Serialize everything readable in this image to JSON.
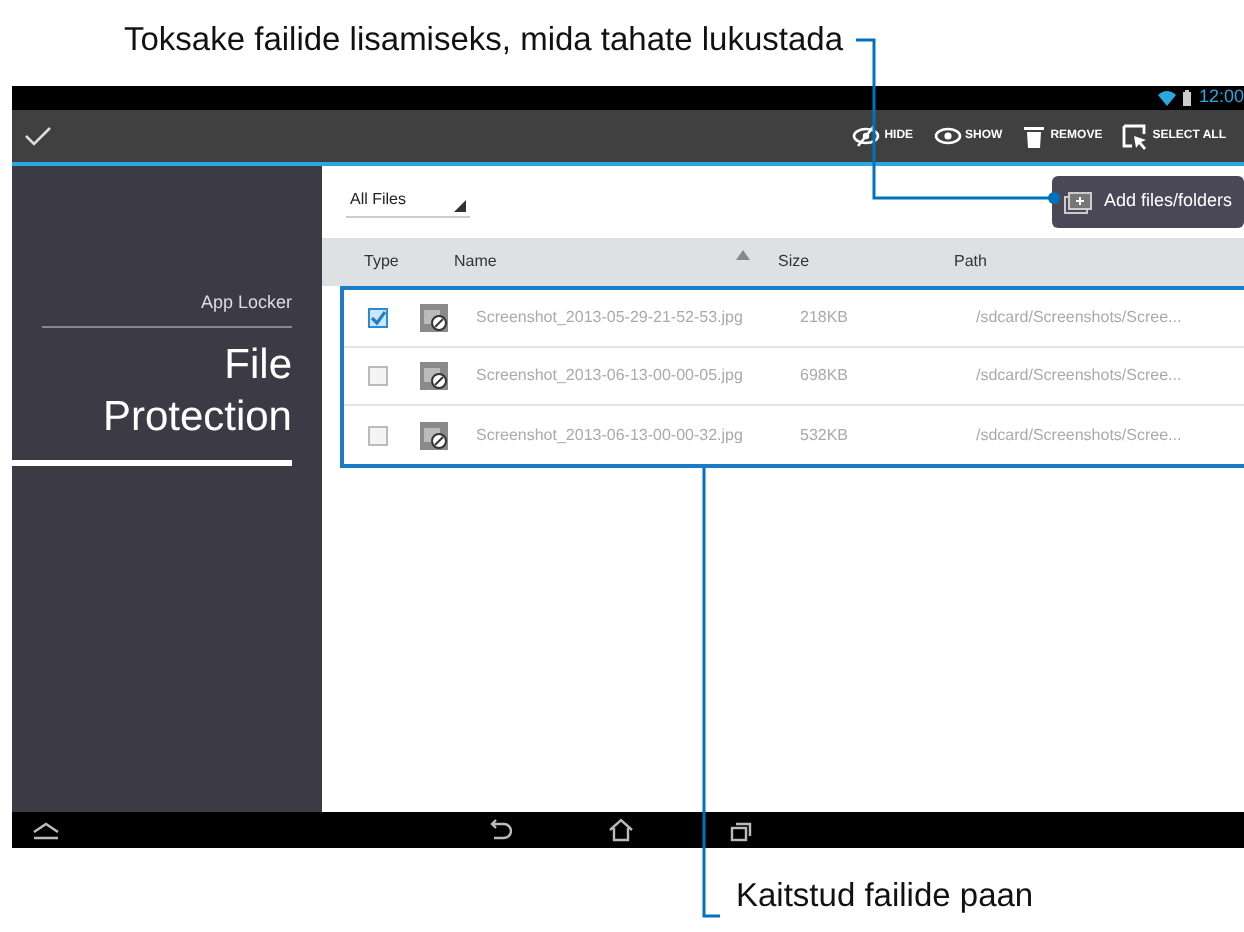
{
  "callouts": [
    {
      "kind": "top",
      "text": "Toksake failide lisamiseks, mida tahate lukustada"
    },
    {
      "kind": "bottom",
      "text": "Kaitstud failide paan"
    }
  ],
  "status_bar": {
    "time": "12:00"
  },
  "action_bar": {
    "actions": [
      {
        "kind": "hide",
        "label": "HIDE"
      },
      {
        "kind": "show",
        "label": "SHOW"
      },
      {
        "kind": "remove",
        "label": "REMOVE"
      },
      {
        "kind": "select",
        "label": "SELECT ALL"
      }
    ]
  },
  "sidebar": {
    "subtitle": "App Locker",
    "title": "File Protection"
  },
  "filter": {
    "value": "All Files"
  },
  "add_button": {
    "label": "Add files/folders"
  },
  "table": {
    "columns": [
      {
        "label": "Type",
        "sorted": false
      },
      {
        "label": "Name",
        "sorted": true
      },
      {
        "label": "Size",
        "sorted": false
      },
      {
        "label": "Path",
        "sorted": false
      }
    ],
    "rows": [
      {
        "checked": true,
        "name": "Screenshot_2013-05-29-21-52-53.jpg",
        "size": "218KB",
        "path": "/sdcard/Screenshots/Scree..."
      },
      {
        "checked": false,
        "name": "Screenshot_2013-06-13-00-00-05.jpg",
        "size": "698KB",
        "path": "/sdcard/Screenshots/Scree..."
      },
      {
        "checked": false,
        "name": "Screenshot_2013-06-13-00-00-32.jpg",
        "size": "532KB",
        "path": "/sdcard/Screenshots/Scree..."
      }
    ]
  }
}
